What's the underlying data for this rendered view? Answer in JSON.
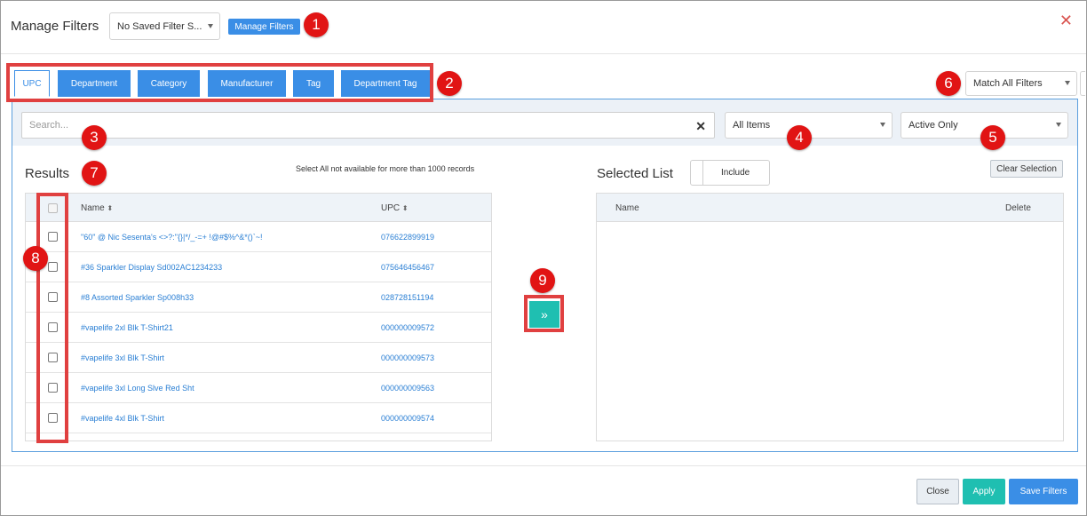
{
  "header": {
    "title": "Manage Filters",
    "saved_filter_value": "No Saved Filter S...",
    "manage_button": "Manage Filters",
    "close_symbol": "✕"
  },
  "tabs": [
    {
      "label": "UPC",
      "active": true
    },
    {
      "label": "Department"
    },
    {
      "label": "Category"
    },
    {
      "label": "Manufacturer"
    },
    {
      "label": "Tag"
    },
    {
      "label": "Department Tag"
    }
  ],
  "match_select": "Match All Filters",
  "search": {
    "placeholder": "Search...",
    "clear_symbol": "✕"
  },
  "items_select": "All Items",
  "status_select": "Active Only",
  "results": {
    "title": "Results",
    "note": "Select All not available for more than 1000 records",
    "columns": {
      "name": "Name",
      "upc": "UPC",
      "sort_symbol": "⬍"
    },
    "rows": [
      {
        "name": "\"60\" @ Nic Sesenta's <>?:\"{}|*/_-=+ !@#$%^&*()`~!",
        "upc": "076622899919"
      },
      {
        "name": "#36 Sparkler Display Sd002AC1234233",
        "upc": "075646456467"
      },
      {
        "name": "#8 Assorted Sparkler Sp008h33",
        "upc": "028728151194"
      },
      {
        "name": "#vapelife 2xl Blk T-Shirt21",
        "upc": "000000009572"
      },
      {
        "name": "#vapelife 3xl Blk T-Shirt",
        "upc": "000000009573"
      },
      {
        "name": "#vapelife 3xl Long Slve Red Sht",
        "upc": "000000009563"
      },
      {
        "name": "#vapelife 4xl Blk T-Shirt",
        "upc": "000000009574"
      }
    ]
  },
  "move_symbol": "»",
  "selected": {
    "title": "Selected List",
    "include_label": "Include",
    "clear_button": "Clear Selection",
    "columns": {
      "name": "Name",
      "delete": "Delete"
    }
  },
  "footer": {
    "close": "Close",
    "apply": "Apply",
    "save": "Save Filters"
  },
  "badges": [
    "1",
    "2",
    "3",
    "4",
    "5",
    "6",
    "7",
    "8",
    "9"
  ],
  "colors": {
    "primary": "#3a8ee6",
    "teal": "#1fbfb1",
    "annotation": "#e11414"
  }
}
